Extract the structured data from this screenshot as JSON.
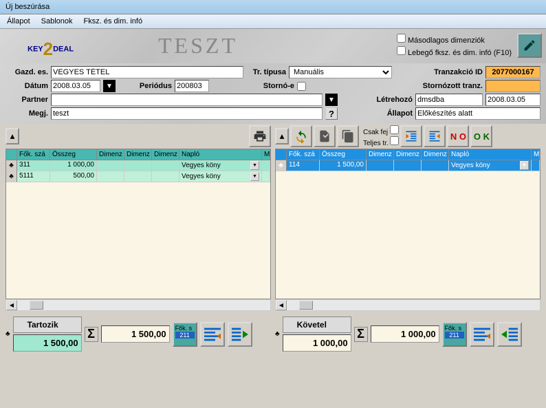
{
  "window": {
    "title": "Új beszúrása"
  },
  "menu": {
    "items": [
      "Állapot",
      "Sablonok",
      "Fksz. és dim. infó"
    ]
  },
  "header": {
    "logo_left": "KEY",
    "logo_right": "DEAL",
    "teszt": "TESZT",
    "chk_masod": "Másodlagos dimenziók",
    "chk_lebego": "Lebegő fksz. és dim. infó  (F10)"
  },
  "form": {
    "gazd_es_label": "Gazd. es.",
    "gazd_es": "VEGYES TÉTEL",
    "tr_tipusa_label": "Tr. típusa",
    "tr_tipusa": "Manuális",
    "tranzakcio_id_label": "Tranzakció ID",
    "tranzakcio_id": "2077000167",
    "datum_label": "Dátum",
    "datum": "2008.03.05",
    "periodus_label": "Periódus",
    "periodus": "200803",
    "storno_e_label": "Stornó-e",
    "stornozott_label": "Stornózott tranz.",
    "partner_label": "Partner",
    "partner": "",
    "letrehozo_label": "Létrehozó",
    "letrehozo": "dmsdba",
    "letrehozo_date": "2008.03.05",
    "megj_label": "Megj.",
    "megj": "teszt",
    "allapot_label": "Állapot",
    "allapot": "Előkészítés alatt"
  },
  "grid_left": {
    "headers": [
      "",
      "Fők. szá",
      "Összeg",
      "Dimenz",
      "Dimenz",
      "Dimenz",
      "Napló",
      "M"
    ],
    "rows": [
      {
        "fok": "311",
        "osszeg": "1 000,00",
        "d1": "",
        "d2": "",
        "d3": "",
        "naplo": "Vegyes köny"
      },
      {
        "fok": "5111",
        "osszeg": "500,00",
        "d1": "",
        "d2": "",
        "d3": "",
        "naplo": "Vegyes köny"
      }
    ]
  },
  "grid_right": {
    "headers": [
      "",
      "Fők. szá",
      "Összeg",
      "Dimenz",
      "Dimenz",
      "Dimenz",
      "Napló",
      "M"
    ],
    "rows": [
      {
        "fok": "114",
        "osszeg": "1 500,00",
        "d1": "",
        "d2": "",
        "d3": "",
        "naplo": "Vegyes köny"
      }
    ]
  },
  "right_toolbar": {
    "csak_fej": "Csak fej",
    "teljes_tr": "Teljes tr.",
    "no": "N O",
    "ok": "O K"
  },
  "footer": {
    "tartozik_label": "Tartozik",
    "tartozik_val": "1 500,00",
    "tartozik_sum": "1 500,00",
    "kovetel_label": "Követel",
    "kovetel_val": "1 000,00",
    "kovetel_sum": "1 000,00",
    "fok_s": "Fők. s",
    "fok_code": "211"
  }
}
